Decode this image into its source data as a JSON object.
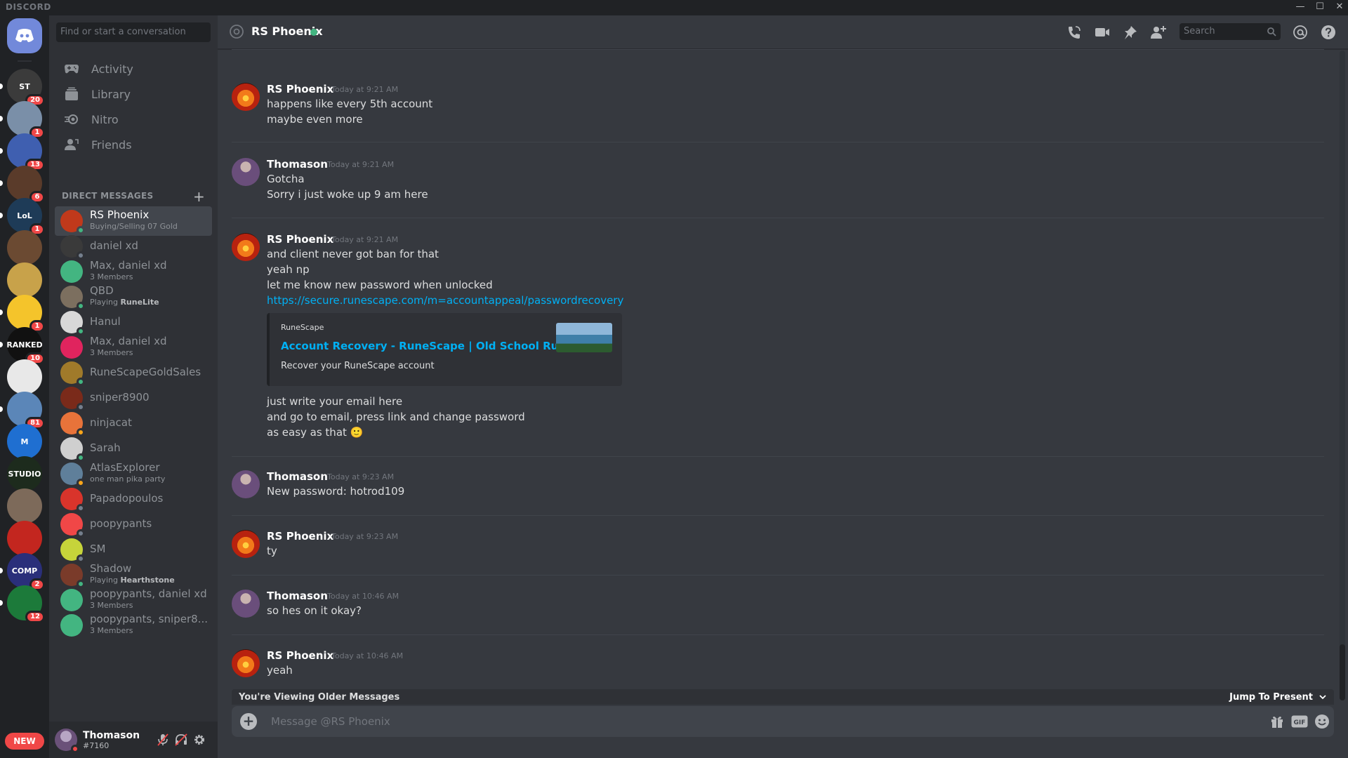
{
  "window": {
    "brand": "DISCORD",
    "controls": [
      "—",
      "☐",
      "✕"
    ]
  },
  "servers": [
    {
      "initials": "ST",
      "color": "#3b3b3b",
      "badge": "20"
    },
    {
      "initials": "",
      "color": "#7a8fa8",
      "badge": "1"
    },
    {
      "initials": "",
      "color": "#3f5fb0",
      "badge": "13"
    },
    {
      "initials": "",
      "color": "#5a3b2a",
      "badge": "6"
    },
    {
      "initials": "LoL",
      "color": "#1e3b57",
      "badge": "1"
    },
    {
      "initials": "",
      "color": "#6b4a32",
      "badge": ""
    },
    {
      "initials": "",
      "color": "#c8a24a",
      "badge": ""
    },
    {
      "initials": "",
      "color": "#f4c42b",
      "badge": "1"
    },
    {
      "initials": "RANKED",
      "color": "#111111",
      "badge": "10"
    },
    {
      "initials": "",
      "color": "#e8e8e8",
      "badge": ""
    },
    {
      "initials": "",
      "color": "#5b86b8",
      "badge": "81"
    },
    {
      "initials": "M",
      "color": "#1f6fd1",
      "badge": ""
    },
    {
      "initials": "STUDIO",
      "color": "#1d2b1d",
      "badge": ""
    },
    {
      "initials": "",
      "color": "#7d6a5a",
      "badge": ""
    },
    {
      "initials": "",
      "color": "#c3261f",
      "badge": ""
    },
    {
      "initials": "COMP",
      "color": "#2a2f7a",
      "badge": "2"
    },
    {
      "initials": "",
      "color": "#1c7a3a",
      "badge": "12"
    }
  ],
  "new_pill": "NEW",
  "sidebar": {
    "search_placeholder": "Find or start a conversation",
    "nav": [
      {
        "label": "Activity",
        "icon": "gamepad-icon"
      },
      {
        "label": "Library",
        "icon": "library-icon"
      },
      {
        "label": "Nitro",
        "icon": "nitro-icon"
      },
      {
        "label": "Friends",
        "icon": "friends-icon"
      }
    ],
    "dm_header": "DIRECT MESSAGES",
    "dms": [
      {
        "name": "RS Phoenix",
        "sub": "Buying/Selling 07 Gold",
        "sub_bold": "",
        "status": "online",
        "color": "#c0391b",
        "active": true
      },
      {
        "name": "daniel xd",
        "sub": "",
        "sub_bold": "",
        "status": "offline",
        "color": "#3a3a3a",
        "active": false
      },
      {
        "name": "Max, daniel xd",
        "sub": "3 Members",
        "sub_bold": "",
        "status": "group",
        "color": "#43b581",
        "active": false
      },
      {
        "name": "QBD",
        "sub": "Playing ",
        "sub_bold": "RuneLite",
        "status": "online",
        "color": "#7c6f5f",
        "active": false
      },
      {
        "name": "Hanul",
        "sub": "",
        "sub_bold": "",
        "status": "online",
        "color": "#d8d8d8",
        "active": false
      },
      {
        "name": "Max, daniel xd",
        "sub": "3 Members",
        "sub_bold": "",
        "status": "group",
        "color": "#e0245e",
        "active": false
      },
      {
        "name": "RuneScapeGoldSales",
        "sub": "",
        "sub_bold": "",
        "status": "online",
        "color": "#a07a2a",
        "active": false
      },
      {
        "name": "sniper8900",
        "sub": "",
        "sub_bold": "",
        "status": "offline",
        "color": "#7a2a1a",
        "active": false
      },
      {
        "name": "ninjacat",
        "sub": "",
        "sub_bold": "",
        "status": "idle",
        "color": "#e8733a",
        "active": false
      },
      {
        "name": "Sarah",
        "sub": "",
        "sub_bold": "",
        "status": "online",
        "color": "#cfcfcf",
        "active": false
      },
      {
        "name": "AtlasExplorer",
        "sub": "one man pika party",
        "sub_bold": "",
        "status": "idle",
        "color": "#5f7f9a",
        "active": false
      },
      {
        "name": "Papadopoulos",
        "sub": "",
        "sub_bold": "",
        "status": "offline",
        "color": "#d9342b",
        "active": false
      },
      {
        "name": "poopypants",
        "sub": "",
        "sub_bold": "",
        "status": "offline",
        "color": "#f04747",
        "active": false
      },
      {
        "name": "SM",
        "sub": "",
        "sub_bold": "",
        "status": "offline",
        "color": "#c6d43a",
        "active": false
      },
      {
        "name": "Shadow",
        "sub": "Playing ",
        "sub_bold": "Hearthstone",
        "status": "online",
        "color": "#7a3b2a",
        "active": false
      },
      {
        "name": "poopypants, daniel xd",
        "sub": "3 Members",
        "sub_bold": "",
        "status": "group",
        "color": "#43b581",
        "active": false
      },
      {
        "name": "poopypants, sniper8...",
        "sub": "3 Members",
        "sub_bold": "",
        "status": "group",
        "color": "#43b581",
        "active": false
      }
    ],
    "user": {
      "name": "Thomason",
      "tag": "#7160"
    }
  },
  "chat": {
    "title": "RS Phoenix",
    "search_placeholder": "Search",
    "messages": [
      {
        "author": "RS Phoenix",
        "avatar": "phoenix",
        "time": "Today at 9:21 AM",
        "lines": [
          "happens like every 5th account",
          "maybe even more"
        ]
      },
      {
        "author": "Thomason",
        "avatar": "thom",
        "time": "Today at 9:21 AM",
        "lines": [
          "Gotcha",
          "Sorry i just woke up 9 am here"
        ]
      },
      {
        "author": "RS Phoenix",
        "avatar": "phoenix",
        "time": "Today at 9:21 AM",
        "lines": [
          "and client never got ban for that",
          "yeah np",
          "let me know new password when unlocked",
          "https://secure.runescape.com/m=accountappeal/passwordrecovery",
          "just write your email here",
          "and go to email, press link and change password",
          "as easy as that 🙂"
        ]
      },
      {
        "author": "Thomason",
        "avatar": "thom",
        "time": "Today at 9:23 AM",
        "lines": [
          "New password: hotrod109"
        ]
      },
      {
        "author": "RS Phoenix",
        "avatar": "phoenix",
        "time": "Today at 9:23 AM",
        "lines": [
          "ty"
        ]
      },
      {
        "author": "Thomason",
        "avatar": "thom",
        "time": "Today at 10:46 AM",
        "lines": [
          "so hes on it okay?"
        ]
      },
      {
        "author": "RS Phoenix",
        "avatar": "phoenix",
        "time": "Today at 10:46 AM",
        "lines": [
          "yeah"
        ]
      }
    ],
    "embed": {
      "provider": "RuneScape",
      "title": "Account Recovery - RuneScape | Old School RuneScape",
      "description": "Recover your RuneScape account"
    },
    "older_bar": {
      "label": "You're Viewing Older Messages",
      "jump": "Jump To Present"
    },
    "composer": {
      "placeholder": "Message @RS Phoenix"
    }
  },
  "colors": {
    "online": "#43b581",
    "idle": "#faa61a",
    "dnd": "#f04747",
    "offline": "#747f8d",
    "link": "#00b0f4",
    "blurple": "#7289da"
  }
}
